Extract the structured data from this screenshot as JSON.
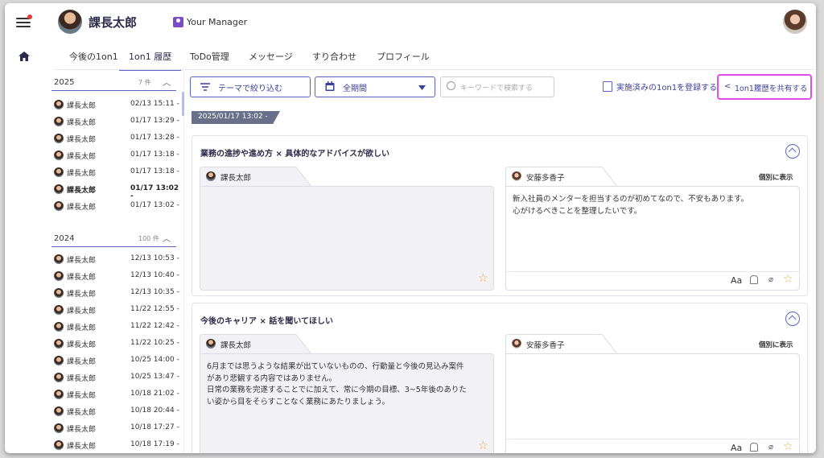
{
  "header": {
    "user_name": "課長太郎",
    "manager_label": "Your Manager"
  },
  "tabs": [
    {
      "label": "今後の1on1"
    },
    {
      "label": "1on1 履歴"
    },
    {
      "label": "ToDo管理"
    },
    {
      "label": "メッセージ"
    },
    {
      "label": "すり合わせ"
    },
    {
      "label": "プロフィール"
    }
  ],
  "sidebar": {
    "groups": [
      {
        "year": "2025",
        "count": "7 件",
        "items": [
          {
            "name": "課長太郎",
            "date": "02/13 15:11 -"
          },
          {
            "name": "課長太郎",
            "date": "01/17 13:29 -"
          },
          {
            "name": "課長太郎",
            "date": "01/17 13:28 -"
          },
          {
            "name": "課長太郎",
            "date": "01/17 13:18 -"
          },
          {
            "name": "課長太郎",
            "date": "01/17 13:18 -"
          },
          {
            "name": "課長太郎",
            "date": "01/17 13:02 -"
          },
          {
            "name": "課長太郎",
            "date": "01/17 13:02 -"
          }
        ]
      },
      {
        "year": "2024",
        "count": "100 件",
        "items": [
          {
            "name": "課長太郎",
            "date": "12/13 10:53 -"
          },
          {
            "name": "課長太郎",
            "date": "12/13 10:40 -"
          },
          {
            "name": "課長太郎",
            "date": "12/13 10:35 -"
          },
          {
            "name": "課長太郎",
            "date": "11/22 12:55 -"
          },
          {
            "name": "課長太郎",
            "date": "11/22 12:42 -"
          },
          {
            "name": "課長太郎",
            "date": "11/22 10:25 -"
          },
          {
            "name": "課長太郎",
            "date": "10/25 14:00 -"
          },
          {
            "name": "課長太郎",
            "date": "10/25 13:47 -"
          },
          {
            "name": "課長太郎",
            "date": "10/18 21:02 -"
          },
          {
            "name": "課長太郎",
            "date": "10/18 20:44 -"
          },
          {
            "name": "課長太郎",
            "date": "10/18 17:27 -"
          },
          {
            "name": "課長太郎",
            "date": "10/18 17:19 -"
          }
        ]
      }
    ]
  },
  "toolbar": {
    "theme_filter_label": "テーマで絞り込む",
    "period_label": "全期間",
    "search_placeholder": "キーワードで検索する",
    "register_label": "実施済みの1on1を登録する",
    "share_label": "1on1履歴を共有する"
  },
  "main": {
    "date_tag": "2025/01/17 13:02 -",
    "individual_label": "個別に表示",
    "cards": [
      {
        "title": "業務の進捗や進め方 × 具体的なアドバイスが欲しい",
        "left_name": "課長太郎",
        "left_text": "",
        "right_name": "安藤多香子",
        "right_text": "新入社員のメンターを担当するのが初めてなので、不安もあります。\n心がけるべきことを整理したいです。"
      },
      {
        "title": "今後のキャリア × 話を聞いてほしい",
        "left_name": "課長太郎",
        "left_text": "6月までは思うような結果が出ていないものの、行動量と今後の見込み案件\nがあり悲観する内容ではありません。\n日常の業務を完遂することでに加えて、常に今期の目標、3~5年後のありた\nい姿から目をそらすことなく業務にあたりましょう。",
        "right_name": "安藤多香子",
        "right_text": ""
      }
    ],
    "font_icon_label": "Aa"
  },
  "icons": [
    "menu-icon",
    "home-icon",
    "person-icon",
    "filter-icon",
    "calendar-icon",
    "search-icon",
    "document-icon",
    "share-icon",
    "chevron-up-icon",
    "star-icon",
    "bell-icon",
    "paperclip-icon"
  ],
  "colors": {
    "accent": "#5a62c8",
    "highlight": "#e54be5",
    "star": "#e8b046",
    "badge": "#e03a3a"
  }
}
